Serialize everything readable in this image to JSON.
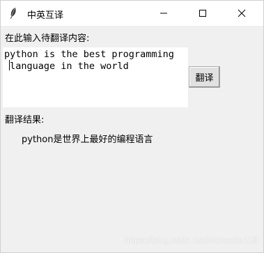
{
  "window": {
    "title": "中英互译",
    "controls": {
      "minimize_icon": "minimize-icon",
      "maximize_icon": "maximize-icon",
      "close_icon": "close-icon"
    }
  },
  "input": {
    "label": "在此输入待翻译内容:",
    "value": "python is the best programming\n language in the world"
  },
  "translate_button": {
    "label": "翻译"
  },
  "result": {
    "label": "翻译结果:",
    "value": "python是世界上最好的编程语言"
  },
  "watermark": "https://blog.csdn.net/momoda118"
}
